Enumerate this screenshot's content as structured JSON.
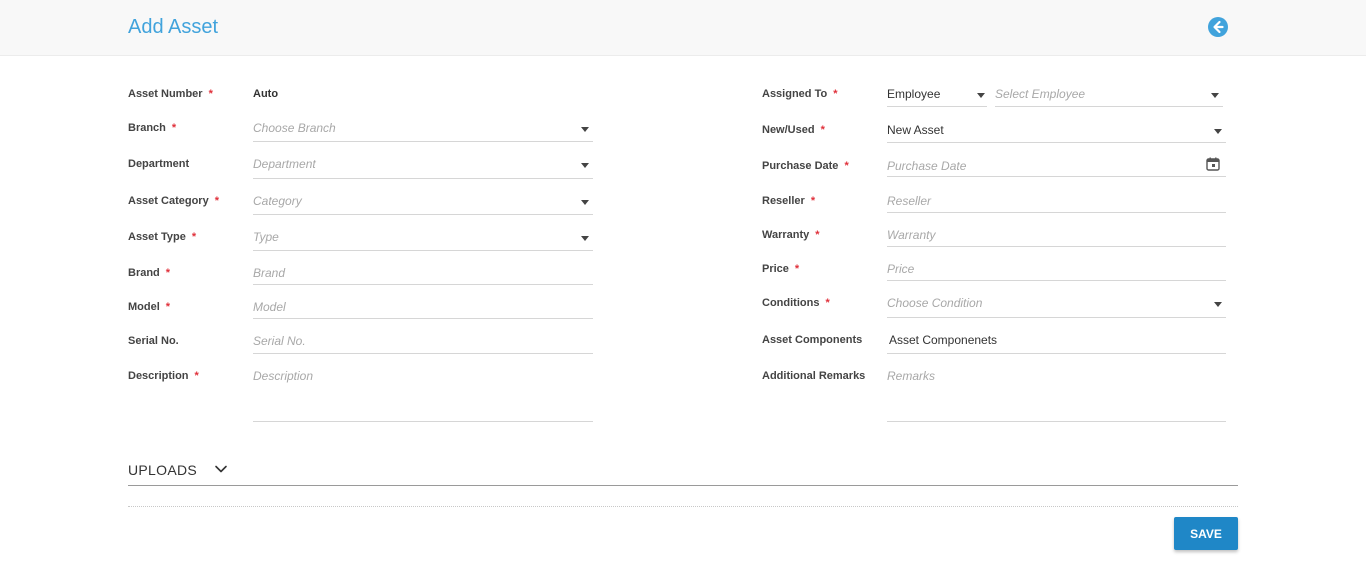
{
  "header": {
    "title": "Add Asset",
    "back_icon": "arrow-left-circle-icon",
    "accent": "#41a3dc"
  },
  "required_mark": "*",
  "left": {
    "asset_number": {
      "label": "Asset Number",
      "value": "Auto"
    },
    "branch": {
      "label": "Branch",
      "placeholder": "Choose Branch"
    },
    "department": {
      "label": "Department",
      "placeholder": "Department"
    },
    "asset_category": {
      "label": "Asset Category",
      "placeholder": "Category"
    },
    "asset_type": {
      "label": "Asset Type",
      "placeholder": "Type"
    },
    "brand": {
      "label": "Brand",
      "placeholder": "Brand"
    },
    "model": {
      "label": "Model",
      "placeholder": "Model"
    },
    "serial_no": {
      "label": "Serial No.",
      "placeholder": "Serial No."
    },
    "description": {
      "label": "Description",
      "placeholder": "Description"
    }
  },
  "right": {
    "assigned_to": {
      "label": "Assigned To",
      "type_value": "Employee",
      "employee_placeholder": "Select Employee"
    },
    "new_used": {
      "label": "New/Used",
      "value": "New Asset"
    },
    "purchase_date": {
      "label": "Purchase Date",
      "placeholder": "Purchase Date"
    },
    "reseller": {
      "label": "Reseller",
      "placeholder": "Reseller"
    },
    "warranty": {
      "label": "Warranty",
      "placeholder": "Warranty"
    },
    "price": {
      "label": "Price",
      "placeholder": "Price"
    },
    "conditions": {
      "label": "Conditions",
      "placeholder": "Choose Condition"
    },
    "asset_components": {
      "label": "Asset Components",
      "value": "Asset Componenets"
    },
    "additional_remarks": {
      "label": "Additional Remarks",
      "placeholder": "Remarks"
    }
  },
  "uploads": {
    "label": "UPLOADS"
  },
  "actions": {
    "save_label": "SAVE",
    "save_color": "#1f87c7"
  }
}
